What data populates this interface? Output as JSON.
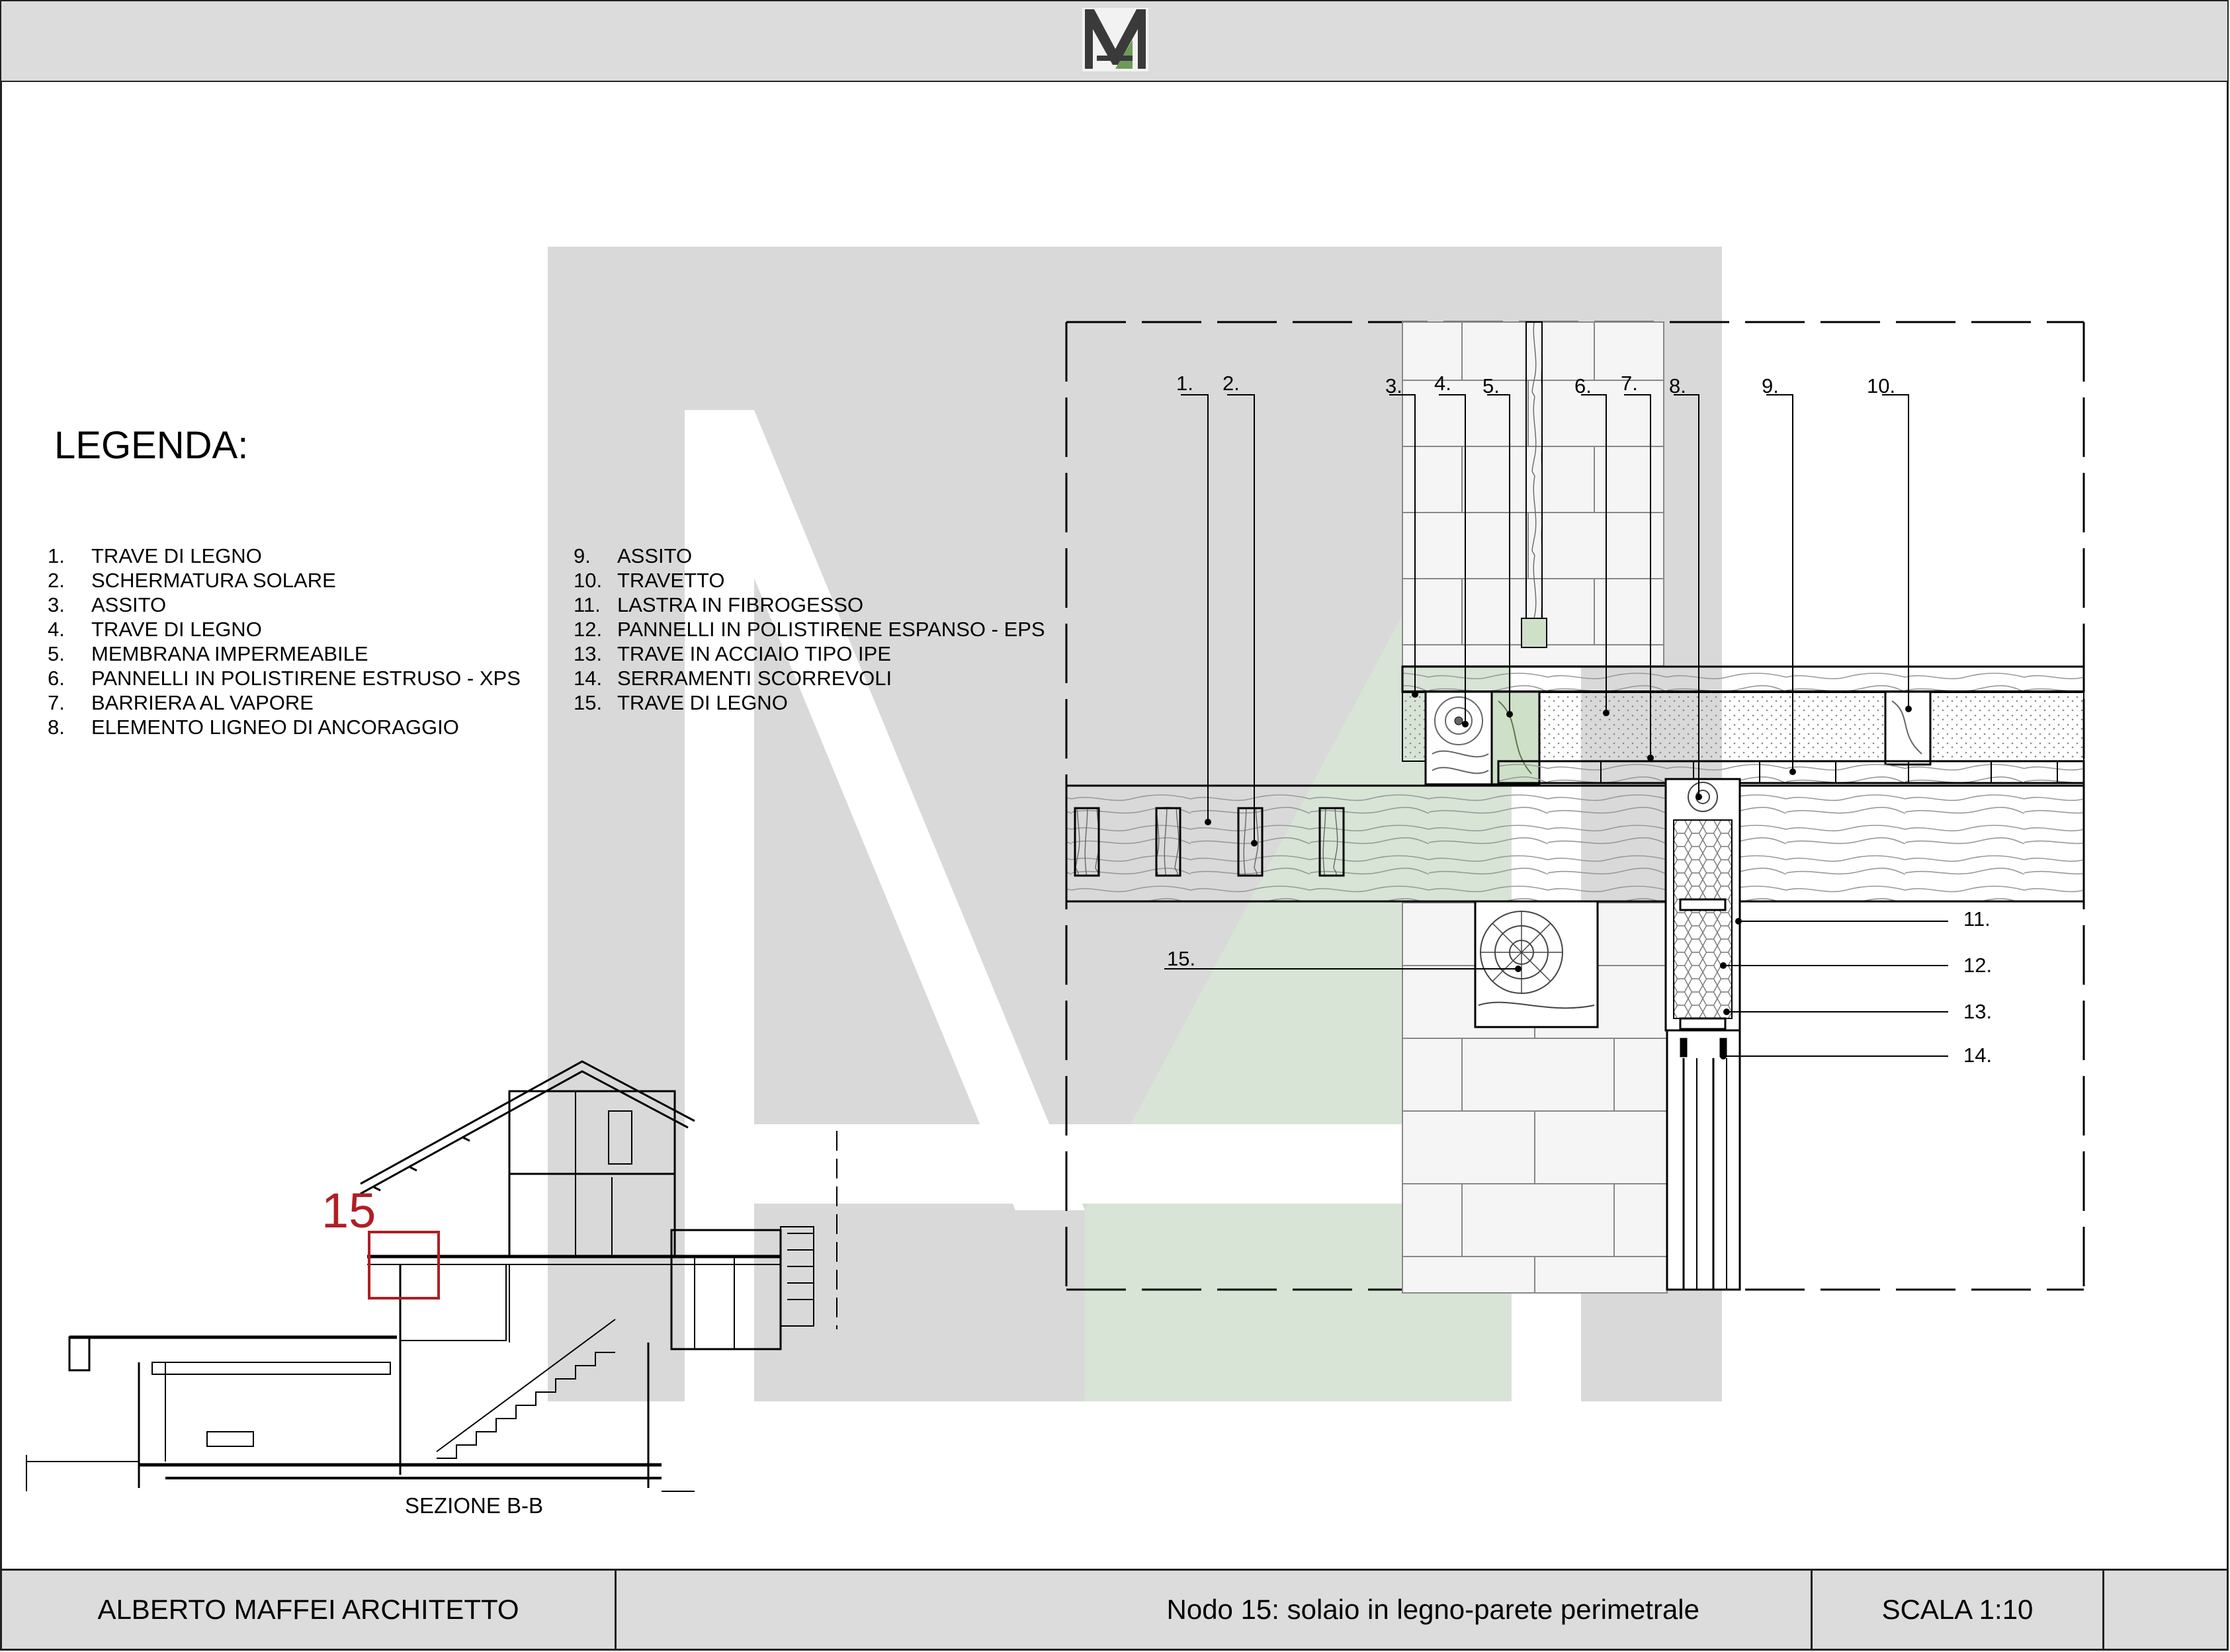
{
  "logo": {
    "name": "architect-monogram-logo",
    "colors": {
      "dark": "#3a3a3a",
      "accent": "#6e9a58"
    }
  },
  "watermark": {
    "name": "monogram-watermark",
    "colors": {
      "grey": "#d9d9d9",
      "green": "#d7e4d6"
    }
  },
  "legend": {
    "title": "LEGENDA:",
    "items_left": [
      {
        "num": "1.",
        "label": "TRAVE DI LEGNO"
      },
      {
        "num": "2.",
        "label": "SCHERMATURA SOLARE"
      },
      {
        "num": "3.",
        "label": "ASSITO"
      },
      {
        "num": "4.",
        "label": "TRAVE DI LEGNO"
      },
      {
        "num": "5.",
        "label": "MEMBRANA IMPERMEABILE"
      },
      {
        "num": "6.",
        "label": "PANNELLI IN POLISTIRENE ESTRUSO - XPS"
      },
      {
        "num": "7.",
        "label": "BARRIERA AL VAPORE"
      },
      {
        "num": "8.",
        "label": "ELEMENTO LIGNEO DI ANCORAGGIO"
      }
    ],
    "items_right": [
      {
        "num": "9.",
        "label": "ASSITO"
      },
      {
        "num": "10.",
        "label": "TRAVETTO"
      },
      {
        "num": "11.",
        "label": "LASTRA IN FIBROGESSO"
      },
      {
        "num": "12.",
        "label": "PANNELLI IN POLISTIRENE ESPANSO - EPS"
      },
      {
        "num": "13.",
        "label": "TRAVE IN ACCIAIO TIPO  IPE"
      },
      {
        "num": "14.",
        "label": "SERRAMENTI SCORREVOLI"
      },
      {
        "num": "15.",
        "label": "TRAVE DI LEGNO"
      }
    ]
  },
  "detail_callouts": {
    "c1": "1.",
    "c2": "2.",
    "c3": "3.",
    "c4": "4.",
    "c5": "5.",
    "c6": "6.",
    "c7": "7.",
    "c8": "8.",
    "c9": "9.",
    "c10": "10.",
    "c11": "11.",
    "c12": "12.",
    "c13": "13.",
    "c14": "14.",
    "c15": "15."
  },
  "section": {
    "label": "SEZIONE B-B",
    "node_number": "15",
    "highlight_color": "#b01e23"
  },
  "title_block": {
    "architect": "ALBERTO MAFFEI ARCHITETTO",
    "drawing_title": "Nodo 15: solaio in legno-parete perimetrale",
    "scale": "SCALA 1:10"
  }
}
